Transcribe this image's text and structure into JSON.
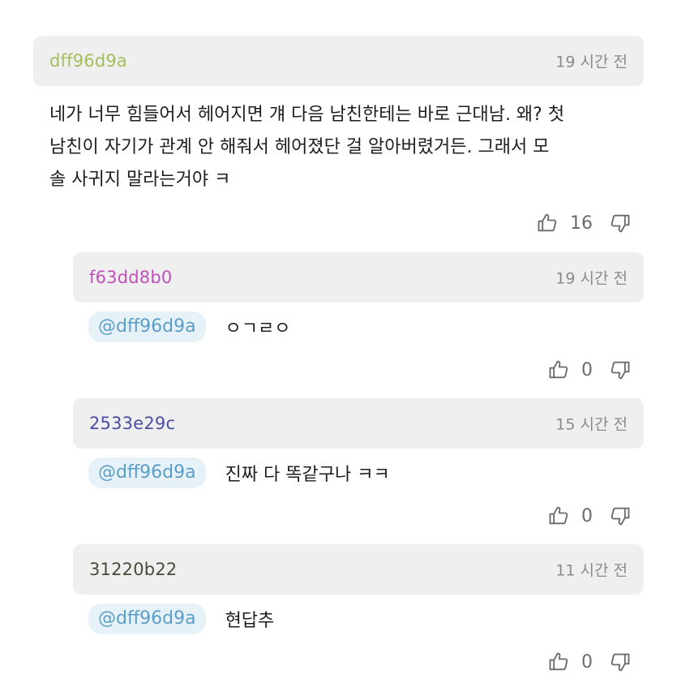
{
  "comments": [
    {
      "user": "dff96d9a",
      "user_color": "#a3bf5b",
      "time": "19 시간 전",
      "lines": [
        "네가 너무 힘들어서 헤어지면 걔 다음 남친한테는 바로 근대남. 왜? 첫",
        "남친이 자기가 관계 안 해줘서 헤어졌단 걸 알아버렸거든. 그래서 모",
        "솔 사귀지 말라는거야 ㅋ"
      ],
      "likes": "16"
    }
  ],
  "replies": [
    {
      "user": "f63dd8b0",
      "user_color": "#c150b8",
      "time": "19 시간 전",
      "mention": "@dff96d9a",
      "text": "ㅇㄱㄹㅇ",
      "likes": "0"
    },
    {
      "user": "2533e29c",
      "user_color": "#4b4ea0",
      "time": "15 시간 전",
      "mention": "@dff96d9a",
      "text": "진짜 다 똑같구나 ㅋㅋ",
      "likes": "0"
    },
    {
      "user": "31220b22",
      "user_color": "#4a4a3a",
      "time": "11 시간 전",
      "mention": "@dff96d9a",
      "text": "현답추",
      "likes": "0"
    }
  ],
  "icons": {
    "like": "thumbs-up-icon",
    "dislike": "thumbs-down-icon"
  }
}
